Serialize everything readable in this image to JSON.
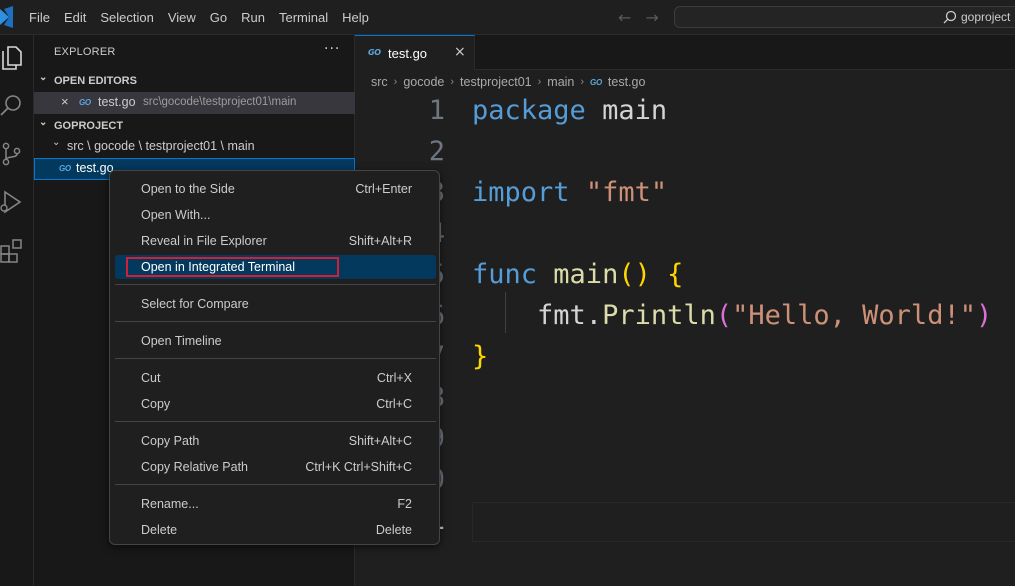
{
  "menubar": {
    "items": [
      "File",
      "Edit",
      "Selection",
      "View",
      "Go",
      "Run",
      "Terminal",
      "Help"
    ],
    "search_label": "goproject"
  },
  "sidebar": {
    "title": "EXPLORER",
    "more": "···",
    "open_editors": {
      "header": "OPEN EDITORS",
      "file": {
        "icon": "GO",
        "name": "test.go",
        "path": "src\\gocode\\testproject01\\main"
      }
    },
    "project": {
      "header": "GOPROJECT",
      "folder_path": "src \\ gocode \\ testproject01 \\ main",
      "file": {
        "icon": "GO",
        "name": "test.go"
      }
    }
  },
  "tab": {
    "icon": "GO",
    "label": "test.go"
  },
  "breadcrumb": {
    "parts": [
      "src",
      "gocode",
      "testproject01",
      "main"
    ],
    "file_icon": "GO",
    "file": "test.go"
  },
  "editor": {
    "line_numbers": [
      "1",
      "2",
      "3",
      "4",
      "5",
      "6",
      "7",
      "8",
      "9",
      "10",
      "11"
    ],
    "code": {
      "l1_kw": "package",
      "l1_name": "main",
      "l3_kw": "import",
      "l3_str": "\"fmt\"",
      "l5_kw": "func",
      "l5_fn": "main",
      "l5_paren": "()",
      "l5_brace": "{",
      "l6_obj": "fmt.",
      "l6_fn": "Println",
      "l6_open": "(",
      "l6_str": "\"Hello, World!\"",
      "l6_close": ")",
      "l7_brace": "}"
    }
  },
  "context_menu": {
    "items": [
      {
        "label": "Open to the Side",
        "key": "Ctrl+Enter"
      },
      {
        "label": "Open With...",
        "key": ""
      },
      {
        "label": "Reveal in File Explorer",
        "key": "Shift+Alt+R"
      },
      {
        "label": "Open in Integrated Terminal",
        "key": ""
      },
      {
        "label": "Select for Compare",
        "key": ""
      },
      {
        "label": "Open Timeline",
        "key": ""
      },
      {
        "label": "Cut",
        "key": "Ctrl+X"
      },
      {
        "label": "Copy",
        "key": "Ctrl+C"
      },
      {
        "label": "Copy Path",
        "key": "Shift+Alt+C"
      },
      {
        "label": "Copy Relative Path",
        "key": "Ctrl+K Ctrl+Shift+C"
      },
      {
        "label": "Rename...",
        "key": "F2"
      },
      {
        "label": "Delete",
        "key": "Delete"
      }
    ]
  },
  "colors": {
    "accent": "#0078d4",
    "highlight_border": "#d21f33",
    "keyword": "#569cd6",
    "string": "#ce9178",
    "function": "#dcdcaa"
  }
}
